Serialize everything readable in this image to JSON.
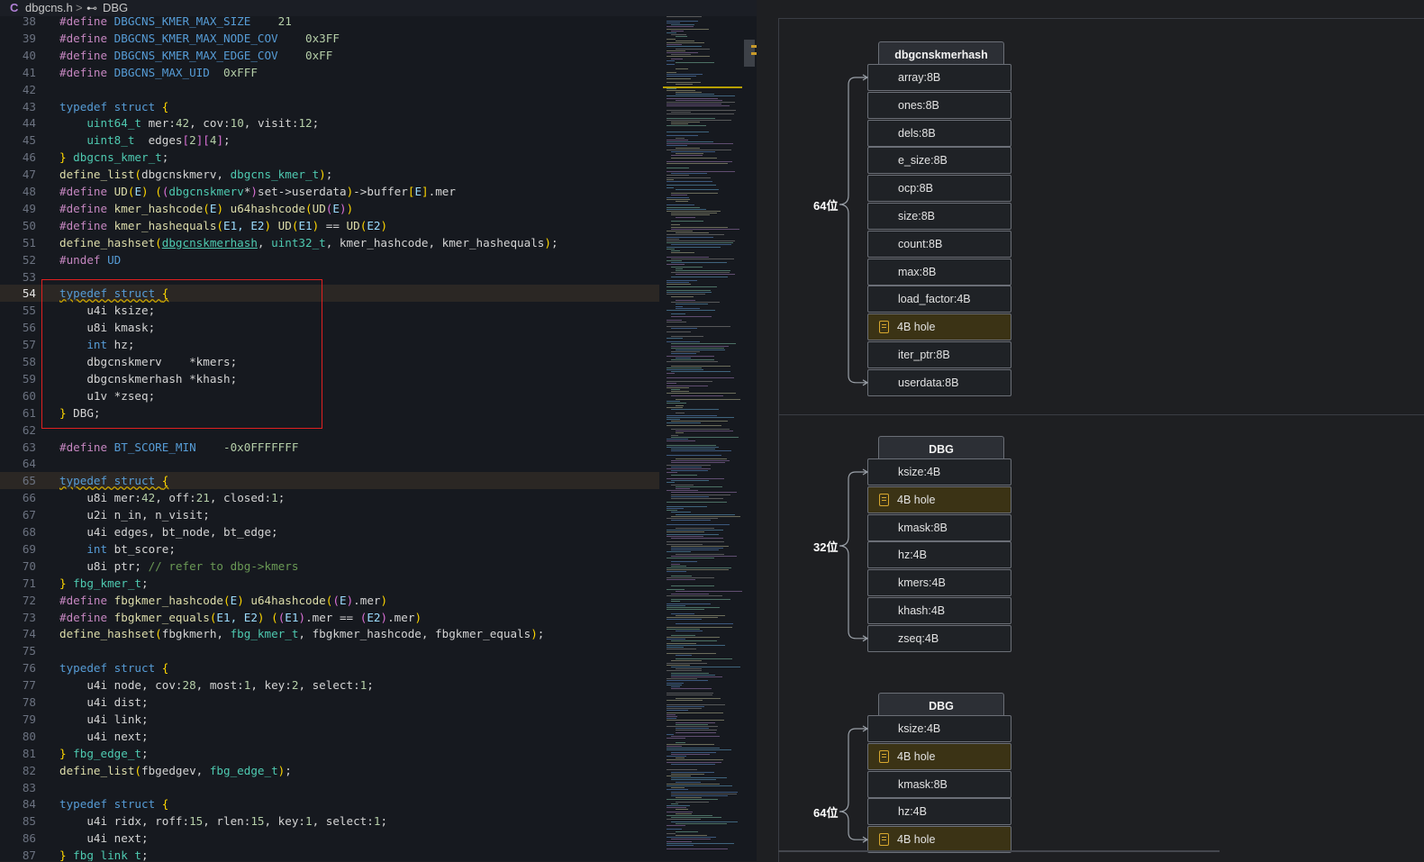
{
  "breadcrumb": {
    "lang_icon": "C",
    "file": "dbgcns.h",
    "separator": ">",
    "symbol_icon": "struct-symbol-icon",
    "symbol": "DBG"
  },
  "code_lines": [
    {
      "n": "38",
      "t": [
        [
          "pp",
          "#define "
        ],
        [
          "mac",
          "DBGCNS_KMER_MAX_SIZE"
        ],
        [
          "op",
          "    "
        ],
        [
          "num",
          "21"
        ]
      ]
    },
    {
      "n": "39",
      "t": [
        [
          "pp",
          "#define "
        ],
        [
          "mac",
          "DBGCNS_KMER_MAX_NODE_COV"
        ],
        [
          "op",
          "    "
        ],
        [
          "num",
          "0x3FF"
        ]
      ]
    },
    {
      "n": "40",
      "t": [
        [
          "pp",
          "#define "
        ],
        [
          "mac",
          "DBGCNS_KMER_MAX_EDGE_COV"
        ],
        [
          "op",
          "    "
        ],
        [
          "num",
          "0xFF"
        ]
      ]
    },
    {
      "n": "41",
      "t": [
        [
          "pp",
          "#define "
        ],
        [
          "mac",
          "DBGCNS_MAX_UID"
        ],
        [
          "op",
          "  "
        ],
        [
          "num",
          "0xFFF"
        ]
      ]
    },
    {
      "n": "42",
      "t": []
    },
    {
      "n": "43",
      "t": [
        [
          "kw",
          "typedef struct "
        ],
        [
          "br",
          "{"
        ]
      ]
    },
    {
      "n": "44",
      "t": [
        [
          "op",
          "    "
        ],
        [
          "ty",
          "uint64_t"
        ],
        [
          "id",
          " mer:"
        ],
        [
          "num",
          "42"
        ],
        [
          "id",
          ", cov:"
        ],
        [
          "num",
          "10"
        ],
        [
          "id",
          ", visit:"
        ],
        [
          "num",
          "12"
        ],
        [
          "id",
          ";"
        ]
      ]
    },
    {
      "n": "45",
      "t": [
        [
          "op",
          "    "
        ],
        [
          "ty",
          "uint8_t"
        ],
        [
          "id",
          "  edges"
        ],
        [
          "br2",
          "["
        ],
        [
          "num",
          "2"
        ],
        [
          "br2",
          "]["
        ],
        [
          "num",
          "4"
        ],
        [
          "br2",
          "]"
        ],
        [
          "id",
          ";"
        ]
      ]
    },
    {
      "n": "46",
      "t": [
        [
          "br",
          "}"
        ],
        [
          "ty",
          " dbgcns_kmer_t"
        ],
        [
          "id",
          ";"
        ]
      ]
    },
    {
      "n": "47",
      "t": [
        [
          "fn",
          "define_list"
        ],
        [
          "br",
          "("
        ],
        [
          "id",
          "dbgcnskmerv, "
        ],
        [
          "ty",
          "dbgcns_kmer_t"
        ],
        [
          "br",
          ")"
        ],
        [
          "id",
          ";"
        ]
      ]
    },
    {
      "n": "48",
      "t": [
        [
          "pp",
          "#define "
        ],
        [
          "fn",
          "UD"
        ],
        [
          "br",
          "("
        ],
        [
          "par",
          "E"
        ],
        [
          "br",
          ")"
        ],
        [
          "id",
          " "
        ],
        [
          "br",
          "("
        ],
        [
          "br2",
          "("
        ],
        [
          "ty",
          "dbgcnskmerv"
        ],
        [
          "id",
          "*"
        ],
        [
          "br2",
          ")"
        ],
        [
          "id",
          "set->userdata"
        ],
        [
          "br",
          ")"
        ],
        [
          "id",
          "->buffer"
        ],
        [
          "br",
          "["
        ],
        [
          "par",
          "E"
        ],
        [
          "br",
          "]"
        ],
        [
          "id",
          ".mer"
        ]
      ]
    },
    {
      "n": "49",
      "t": [
        [
          "pp",
          "#define "
        ],
        [
          "fn",
          "kmer_hashcode"
        ],
        [
          "br",
          "("
        ],
        [
          "par",
          "E"
        ],
        [
          "br",
          ")"
        ],
        [
          "fn",
          " u64hashcode"
        ],
        [
          "br",
          "("
        ],
        [
          "fn",
          "UD"
        ],
        [
          "br2",
          "("
        ],
        [
          "par",
          "E"
        ],
        [
          "br2",
          ")"
        ],
        [
          "br",
          ")"
        ]
      ]
    },
    {
      "n": "50",
      "t": [
        [
          "pp",
          "#define "
        ],
        [
          "fn",
          "kmer_hashequals"
        ],
        [
          "br",
          "("
        ],
        [
          "par",
          "E1, E2"
        ],
        [
          "br",
          ")"
        ],
        [
          "fn",
          " UD"
        ],
        [
          "br",
          "("
        ],
        [
          "par",
          "E1"
        ],
        [
          "br",
          ")"
        ],
        [
          "id",
          " == "
        ],
        [
          "fn",
          "UD"
        ],
        [
          "br",
          "("
        ],
        [
          "par",
          "E2"
        ],
        [
          "br",
          ")"
        ]
      ]
    },
    {
      "n": "51",
      "t": [
        [
          "fn",
          "define_hashset"
        ],
        [
          "br",
          "("
        ],
        [
          "tyu",
          "dbgcnskmerhash"
        ],
        [
          "id",
          ", "
        ],
        [
          "ty",
          "uint32_t"
        ],
        [
          "id",
          ", kmer_hashcode, kmer_hashequals"
        ],
        [
          "br",
          ")"
        ],
        [
          "id",
          ";"
        ]
      ]
    },
    {
      "n": "52",
      "t": [
        [
          "pp",
          "#undef "
        ],
        [
          "mac",
          "UD"
        ]
      ]
    },
    {
      "n": "53",
      "t": []
    },
    {
      "n": "54",
      "hl": true,
      "active": true,
      "t": [
        [
          "kwsq",
          "typedef struct "
        ],
        [
          "brsq",
          "{"
        ]
      ]
    },
    {
      "n": "55",
      "t": [
        [
          "op",
          "    "
        ],
        [
          "id",
          "u4i ksize;"
        ]
      ]
    },
    {
      "n": "56",
      "t": [
        [
          "op",
          "    "
        ],
        [
          "id",
          "u8i kmask;"
        ]
      ]
    },
    {
      "n": "57",
      "t": [
        [
          "op",
          "    "
        ],
        [
          "kw",
          "int"
        ],
        [
          "id",
          " hz;"
        ]
      ]
    },
    {
      "n": "58",
      "t": [
        [
          "op",
          "    "
        ],
        [
          "id",
          "dbgcnskmerv    *kmers;"
        ]
      ]
    },
    {
      "n": "59",
      "t": [
        [
          "op",
          "    "
        ],
        [
          "id",
          "dbgcnskmerhash *khash;"
        ]
      ]
    },
    {
      "n": "60",
      "t": [
        [
          "op",
          "    "
        ],
        [
          "id",
          "u1v *zseq;"
        ]
      ]
    },
    {
      "n": "61",
      "t": [
        [
          "br",
          "}"
        ],
        [
          "id",
          " DBG;"
        ]
      ]
    },
    {
      "n": "62",
      "t": []
    },
    {
      "n": "63",
      "t": [
        [
          "pp",
          "#define "
        ],
        [
          "mac",
          "BT_SCORE_MIN"
        ],
        [
          "op",
          "    "
        ],
        [
          "num",
          "-0x0FFFFFFF"
        ]
      ]
    },
    {
      "n": "64",
      "t": []
    },
    {
      "n": "65",
      "hl": true,
      "t": [
        [
          "kwsq",
          "typedef struct "
        ],
        [
          "brsq",
          "{"
        ]
      ]
    },
    {
      "n": "66",
      "t": [
        [
          "op",
          "    "
        ],
        [
          "id",
          "u8i mer:"
        ],
        [
          "num",
          "42"
        ],
        [
          "id",
          ", off:"
        ],
        [
          "num",
          "21"
        ],
        [
          "id",
          ", closed:"
        ],
        [
          "num",
          "1"
        ],
        [
          "id",
          ";"
        ]
      ]
    },
    {
      "n": "67",
      "t": [
        [
          "op",
          "    "
        ],
        [
          "id",
          "u2i n_in, n_visit;"
        ]
      ]
    },
    {
      "n": "68",
      "t": [
        [
          "op",
          "    "
        ],
        [
          "id",
          "u4i edges, bt_node, bt_edge;"
        ]
      ]
    },
    {
      "n": "69",
      "t": [
        [
          "op",
          "    "
        ],
        [
          "kw",
          "int"
        ],
        [
          "id",
          " bt_score;"
        ]
      ]
    },
    {
      "n": "70",
      "t": [
        [
          "op",
          "    "
        ],
        [
          "id",
          "u8i ptr; "
        ],
        [
          "cmt",
          "// refer to dbg->kmers"
        ]
      ]
    },
    {
      "n": "71",
      "t": [
        [
          "br",
          "}"
        ],
        [
          "ty",
          " fbg_kmer_t"
        ],
        [
          "id",
          ";"
        ]
      ]
    },
    {
      "n": "72",
      "t": [
        [
          "pp",
          "#define "
        ],
        [
          "fn",
          "fbgkmer_hashcode"
        ],
        [
          "br",
          "("
        ],
        [
          "par",
          "E"
        ],
        [
          "br",
          ")"
        ],
        [
          "fn",
          " u64hashcode"
        ],
        [
          "br",
          "("
        ],
        [
          "br2",
          "("
        ],
        [
          "par",
          "E"
        ],
        [
          "br2",
          ")"
        ],
        [
          "id",
          ".mer"
        ],
        [
          "br",
          ")"
        ]
      ]
    },
    {
      "n": "73",
      "t": [
        [
          "pp",
          "#define "
        ],
        [
          "fn",
          "fbgkmer_equals"
        ],
        [
          "br",
          "("
        ],
        [
          "par",
          "E1, E2"
        ],
        [
          "br",
          ")"
        ],
        [
          "id",
          " "
        ],
        [
          "br",
          "("
        ],
        [
          "br2",
          "("
        ],
        [
          "par",
          "E1"
        ],
        [
          "br2",
          ")"
        ],
        [
          "id",
          ".mer == "
        ],
        [
          "br2",
          "("
        ],
        [
          "par",
          "E2"
        ],
        [
          "br2",
          ")"
        ],
        [
          "id",
          ".mer"
        ],
        [
          "br",
          ")"
        ]
      ]
    },
    {
      "n": "74",
      "t": [
        [
          "fn",
          "define_hashset"
        ],
        [
          "br",
          "("
        ],
        [
          "id",
          "fbgkmerh, "
        ],
        [
          "ty",
          "fbg_kmer_t"
        ],
        [
          "id",
          ", fbgkmer_hashcode, fbgkmer_equals"
        ],
        [
          "br",
          ")"
        ],
        [
          "id",
          ";"
        ]
      ]
    },
    {
      "n": "75",
      "t": []
    },
    {
      "n": "76",
      "t": [
        [
          "kw",
          "typedef struct "
        ],
        [
          "br",
          "{"
        ]
      ]
    },
    {
      "n": "77",
      "t": [
        [
          "op",
          "    "
        ],
        [
          "id",
          "u4i node, cov:"
        ],
        [
          "num",
          "28"
        ],
        [
          "id",
          ", most:"
        ],
        [
          "num",
          "1"
        ],
        [
          "id",
          ", key:"
        ],
        [
          "num",
          "2"
        ],
        [
          "id",
          ", select:"
        ],
        [
          "num",
          "1"
        ],
        [
          "id",
          ";"
        ]
      ]
    },
    {
      "n": "78",
      "t": [
        [
          "op",
          "    "
        ],
        [
          "id",
          "u4i dist;"
        ]
      ]
    },
    {
      "n": "79",
      "t": [
        [
          "op",
          "    "
        ],
        [
          "id",
          "u4i link;"
        ]
      ]
    },
    {
      "n": "80",
      "t": [
        [
          "op",
          "    "
        ],
        [
          "id",
          "u4i next;"
        ]
      ]
    },
    {
      "n": "81",
      "t": [
        [
          "br",
          "}"
        ],
        [
          "ty",
          " fbg_edge_t"
        ],
        [
          "id",
          ";"
        ]
      ]
    },
    {
      "n": "82",
      "t": [
        [
          "fn",
          "define_list"
        ],
        [
          "br",
          "("
        ],
        [
          "id",
          "fbgedgev, "
        ],
        [
          "ty",
          "fbg_edge_t"
        ],
        [
          "br",
          ")"
        ],
        [
          "id",
          ";"
        ]
      ]
    },
    {
      "n": "83",
      "t": []
    },
    {
      "n": "84",
      "t": [
        [
          "kw",
          "typedef struct "
        ],
        [
          "br",
          "{"
        ]
      ]
    },
    {
      "n": "85",
      "t": [
        [
          "op",
          "    "
        ],
        [
          "id",
          "u4i ridx, roff:"
        ],
        [
          "num",
          "15"
        ],
        [
          "id",
          ", rlen:"
        ],
        [
          "num",
          "15"
        ],
        [
          "id",
          ", key:"
        ],
        [
          "num",
          "1"
        ],
        [
          "id",
          ", select:"
        ],
        [
          "num",
          "1"
        ],
        [
          "id",
          ";"
        ]
      ]
    },
    {
      "n": "86",
      "t": [
        [
          "op",
          "    "
        ],
        [
          "id",
          "u4i next;"
        ]
      ]
    },
    {
      "n": "87",
      "t": [
        [
          "br",
          "}"
        ],
        [
          "ty",
          " fbg_link_t"
        ],
        [
          "id",
          ";"
        ]
      ]
    }
  ],
  "structs": [
    {
      "title": "dbgcnskmerhash",
      "brace_label": "64位",
      "fields": [
        {
          "label": "array:8B",
          "hole": false
        },
        {
          "label": "ones:8B",
          "hole": false
        },
        {
          "label": "dels:8B",
          "hole": false
        },
        {
          "label": "e_size:8B",
          "hole": false
        },
        {
          "label": "ocp:8B",
          "hole": false
        },
        {
          "label": "size:8B",
          "hole": false
        },
        {
          "label": "count:8B",
          "hole": false
        },
        {
          "label": "max:8B",
          "hole": false
        },
        {
          "label": "load_factor:4B",
          "hole": false
        },
        {
          "label": "4B hole",
          "hole": true
        },
        {
          "label": "iter_ptr:8B",
          "hole": false
        },
        {
          "label": "userdata:8B",
          "hole": false
        }
      ]
    },
    {
      "title": "DBG",
      "brace_label": "32位",
      "fields": [
        {
          "label": "ksize:4B",
          "hole": false
        },
        {
          "label": "4B hole",
          "hole": true
        },
        {
          "label": "kmask:8B",
          "hole": false
        },
        {
          "label": "hz:4B",
          "hole": false
        },
        {
          "label": "kmers:4B",
          "hole": false
        },
        {
          "label": "khash:4B",
          "hole": false
        },
        {
          "label": "zseq:4B",
          "hole": false
        }
      ]
    },
    {
      "title": "DBG",
      "brace_label": "64位",
      "fields": [
        {
          "label": "ksize:4B",
          "hole": false
        },
        {
          "label": "4B hole",
          "hole": true
        },
        {
          "label": "kmask:8B",
          "hole": false
        },
        {
          "label": "hz:4B",
          "hole": false
        },
        {
          "label": "4B hole",
          "hole": true
        }
      ]
    }
  ],
  "colors": {
    "accent_hole": "#d7a72e",
    "selection_box": "#e02020",
    "editor_bg": "#16191f"
  }
}
